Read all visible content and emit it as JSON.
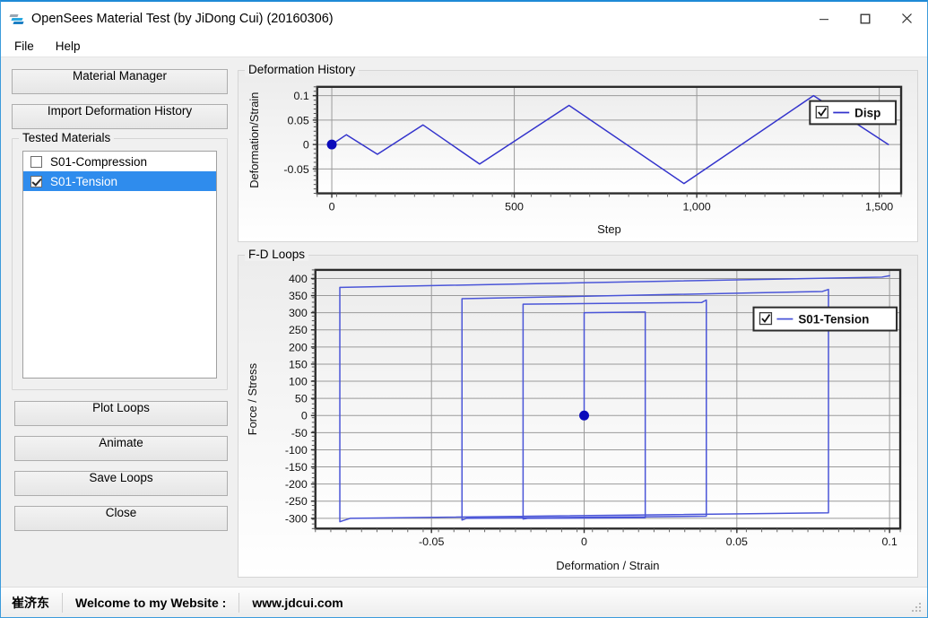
{
  "window": {
    "title": "OpenSees Material Test (by JiDong Cui) (20160306)",
    "icon": "opensees-app-icon",
    "minimize_label": "—",
    "maximize_label": "□",
    "close_label": "✕"
  },
  "menu": {
    "items": [
      {
        "label": "File"
      },
      {
        "label": "Help"
      }
    ]
  },
  "sidebar": {
    "material_manager_label": "Material Manager",
    "import_history_label": "Import Deformation History",
    "group_label": "Tested Materials",
    "materials": [
      {
        "label": "S01-Compression",
        "checked": false,
        "selected": false
      },
      {
        "label": "S01-Tension",
        "checked": true,
        "selected": true
      }
    ],
    "plot_loops_label": "Plot Loops",
    "animate_label": "Animate",
    "save_loops_label": "Save Loops",
    "close_label": "Close"
  },
  "panels": {
    "deformation_history_label": "Deformation History",
    "fd_loops_label": "F-D Loops"
  },
  "statusbar": {
    "author": "崔济东",
    "welcome": "Welcome to my Website :",
    "website": "www.jdcui.com"
  },
  "colors": {
    "series": "#3333cc",
    "series_fd": "#4a55d8",
    "marker": "#0b0bbb",
    "selection": "#2f8ced",
    "plot_border": "#2b2b2b",
    "grid": "#9a9a9a",
    "plot_bg_top": "#ececec",
    "plot_bg_bottom": "#ffffff"
  },
  "chart_data": [
    {
      "id": "deformation-history",
      "type": "line",
      "title": "Deformation History",
      "xlabel": "Step",
      "ylabel": "Deformation/Strain",
      "xlim": [
        -40,
        1560
      ],
      "ylim": [
        -0.1,
        0.118
      ],
      "xticks": [
        0,
        500,
        1000,
        1500
      ],
      "xticklabels": [
        "0",
        "500",
        "1,000",
        "1,500"
      ],
      "yticks": [
        -0.05,
        0,
        0.05,
        0.1
      ],
      "yticklabels": [
        "-0.05",
        "0",
        "0.05",
        "0.1"
      ],
      "grid": true,
      "legend": {
        "position": "top-right",
        "entries": [
          {
            "label": "Disp",
            "checked": true
          }
        ]
      },
      "marker_points": [
        {
          "x": 0,
          "y": 0
        }
      ],
      "series": [
        {
          "name": "Disp",
          "x": [
            0,
            40,
            125,
            250,
            405,
            650,
            965,
            1320,
            1525
          ],
          "y": [
            0,
            0.02,
            -0.02,
            0.04,
            -0.04,
            0.08,
            -0.08,
            0.1,
            0.0
          ]
        }
      ]
    },
    {
      "id": "fd-loops",
      "type": "line",
      "title": "F-D Loops",
      "xlabel": "Deformation / Strain",
      "ylabel": "Force / Stress",
      "xlim": [
        -0.088,
        0.1035
      ],
      "ylim": [
        -330,
        425
      ],
      "xticks": [
        -0.05,
        0,
        0.05,
        0.1
      ],
      "xticklabels": [
        "-0.05",
        "0",
        "0.05",
        "0.1"
      ],
      "yticks": [
        -300,
        -250,
        -200,
        -150,
        -100,
        -50,
        0,
        50,
        100,
        150,
        200,
        250,
        300,
        350,
        400
      ],
      "yticklabels": [
        "-300",
        "-250",
        "-200",
        "-150",
        "-100",
        "-50",
        "0",
        "50",
        "100",
        "150",
        "200",
        "250",
        "300",
        "350",
        "400"
      ],
      "grid": true,
      "legend": {
        "position": "top-right",
        "entries": [
          {
            "label": "S01-Tension",
            "checked": true
          }
        ]
      },
      "marker_points": [
        {
          "x": 0,
          "y": 0
        }
      ],
      "series": [
        {
          "name": "S01-Tension",
          "comment": "kinematic-hardening hysteresis, cycles at +-0.02, +-0.04, +-0.08, then to 0.1",
          "x": [
            0,
            0.0,
            0.019,
            0.02,
            0.02,
            -0.0185,
            -0.02,
            -0.02,
            0.0385,
            0.04,
            0.04,
            -0.0385,
            -0.04,
            -0.04,
            0.078,
            0.08,
            0.08,
            -0.0765,
            -0.08,
            -0.08,
            0.0975,
            0.1,
            0.1
          ],
          "y": [
            0,
            300.0,
            302.0,
            302.0,
            -298.0,
            -300.0,
            -302.0,
            325.0,
            330.0,
            337.0,
            -294.0,
            -300.0,
            -305.0,
            341.0,
            362.0,
            368.0,
            -284.0,
            -300.0,
            -310.0,
            374.0,
            404.0,
            408.0,
            408.0
          ]
        }
      ]
    }
  ]
}
